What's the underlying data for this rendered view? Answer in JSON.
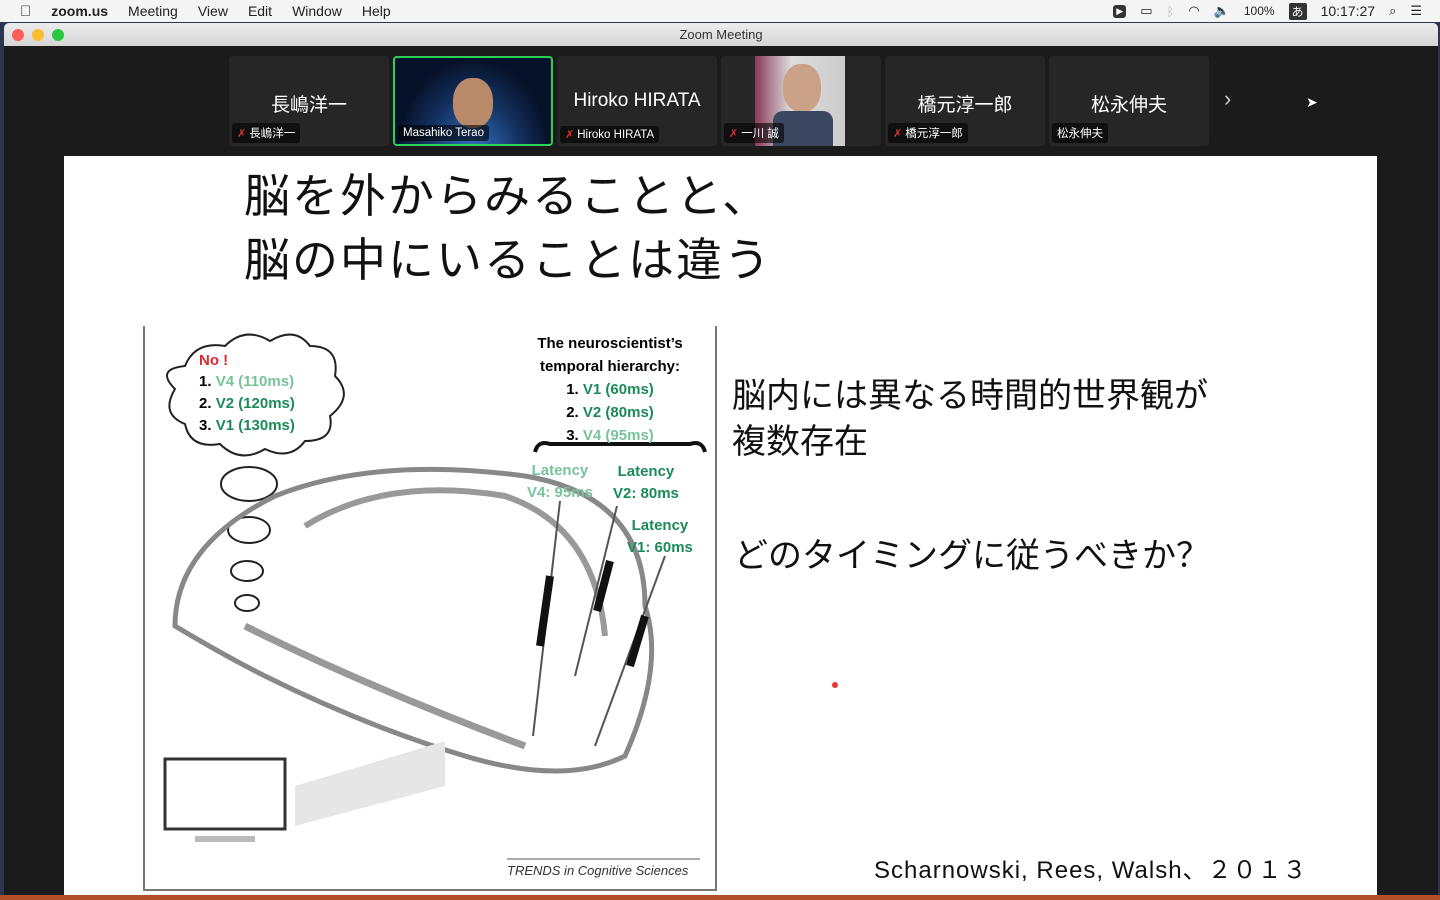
{
  "menubar": {
    "app": "zoom.us",
    "items": [
      "Meeting",
      "View",
      "Edit",
      "Window",
      "Help"
    ],
    "battery": "100%",
    "input_method": "あ",
    "time": "10:17:27"
  },
  "window": {
    "title": "Zoom Meeting"
  },
  "participants": [
    {
      "display": "長嶋洋一",
      "label": "長嶋洋一",
      "muted": true,
      "video": false
    },
    {
      "display": "",
      "label": "Masahiko Terao",
      "muted": false,
      "video": true,
      "active": true
    },
    {
      "display": "Hiroko HIRATA",
      "label": "Hiroko HIRATA",
      "muted": true,
      "video": false
    },
    {
      "display": "",
      "label": "一川 誠",
      "muted": true,
      "video": true
    },
    {
      "display": "橋元淳一郎",
      "label": "橋元淳一郎",
      "muted": true,
      "video": false
    },
    {
      "display": "松永伸夫",
      "label": "松永伸夫",
      "muted": false,
      "video": false
    }
  ],
  "slide": {
    "title_line1": "脳を外からみることと、",
    "title_line2": "脳の中にいることは違う",
    "right_line1": "脳内には異なる時間的世界観が",
    "right_line2": "複数存在",
    "question": "どのタイミングに従うべきか？",
    "citation": "Scharnowski, Rees, Walsh、２０１３",
    "figure": {
      "no": "No !",
      "bubble": [
        "1.",
        "V4 (110ms)",
        "2.",
        "V2 (120ms)",
        "3.",
        "V1 (130ms)"
      ],
      "hier_title1": "The neuroscientist’s",
      "hier_title2": "temporal hierarchy:",
      "hier": [
        "1.",
        "V1 (60ms)",
        "2.",
        "V2 (80ms)",
        "3.",
        "V4 (95ms)"
      ],
      "lat_v4": [
        "Latency",
        "V4: 95ms"
      ],
      "lat_v2": [
        "Latency",
        "V2: 80ms"
      ],
      "lat_v1": [
        "Latency",
        "V1: 60ms"
      ],
      "source": "TRENDS in Cognitive Sciences"
    }
  }
}
